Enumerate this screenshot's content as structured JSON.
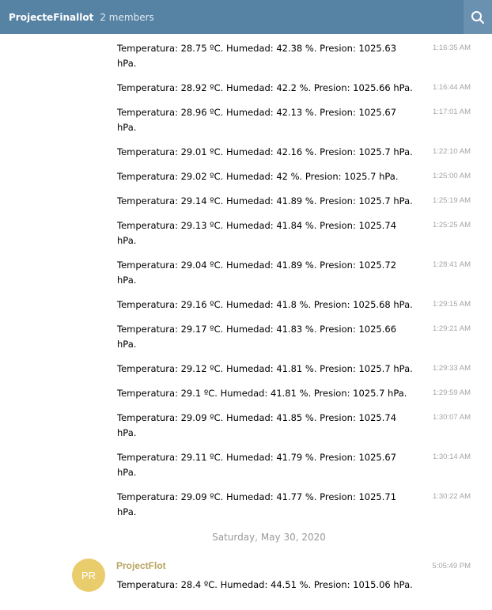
{
  "header": {
    "title": "ProjecteFinallot",
    "members": "2 members",
    "search_icon": "search-icon",
    "bg_color": "#5682a3"
  },
  "messages": [
    {
      "text": "Temperatura: 28.75 ºC. Humedad: 42.38 %. Presion: 1025.63 hPa.",
      "time": "1:16:35 AM"
    },
    {
      "text": "Temperatura: 28.92 ºC. Humedad: 42.2 %. Presion: 1025.66 hPa.",
      "time": "1:16:44 AM"
    },
    {
      "text": "Temperatura: 28.96 ºC. Humedad: 42.13 %. Presion: 1025.67 hPa.",
      "time": "1:17:01 AM"
    },
    {
      "text": "Temperatura: 29.01 ºC. Humedad: 42.16 %. Presion: 1025.7 hPa.",
      "time": "1:22:10 AM"
    },
    {
      "text": "Temperatura: 29.02 ºC. Humedad: 42 %. Presion: 1025.7 hPa.",
      "time": "1:25:00 AM"
    },
    {
      "text": "Temperatura: 29.14 ºC. Humedad: 41.89 %. Presion: 1025.7 hPa.",
      "time": "1:25:19 AM"
    },
    {
      "text": "Temperatura: 29.13 ºC. Humedad: 41.84 %. Presion: 1025.74 hPa.",
      "time": "1:25:25 AM"
    },
    {
      "text": "Temperatura: 29.04 ºC. Humedad: 41.89 %. Presion: 1025.72 hPa.",
      "time": "1:28:41 AM"
    },
    {
      "text": "Temperatura: 29.16 ºC. Humedad: 41.8 %. Presion: 1025.68 hPa.",
      "time": "1:29:15 AM"
    },
    {
      "text": "Temperatura: 29.17 ºC. Humedad: 41.83 %. Presion: 1025.66 hPa.",
      "time": "1:29:21 AM"
    },
    {
      "text": "Temperatura: 29.12 ºC. Humedad: 41.81 %. Presion: 1025.7 hPa.",
      "time": "1:29:33 AM"
    },
    {
      "text": "Temperatura: 29.1 ºC. Humedad: 41.81 %. Presion: 1025.7 hPa.",
      "time": "1:29:59 AM"
    },
    {
      "text": "Temperatura: 29.09 ºC. Humedad: 41.85 %. Presion: 1025.74 hPa.",
      "time": "1:30:07 AM"
    },
    {
      "text": "Temperatura: 29.11 ºC. Humedad: 41.79 %. Presion: 1025.67 hPa.",
      "time": "1:30:14 AM"
    },
    {
      "text": "Temperatura: 29.09 ºC. Humedad: 41.77 %. Presion: 1025.71 hPa.",
      "time": "1:30:22 AM"
    }
  ],
  "date_separator": "Saturday, May 30, 2020",
  "last_message": {
    "avatar_initials": "PR",
    "avatar_color": "#e9cc6c",
    "author": "ProjectFlot",
    "author_color": "#b8a460",
    "time": "5:05:49 PM",
    "text": "Temperatura: 28.4 ºC. Humedad: 44.51 %. Presion: 1015.06 hPa."
  }
}
